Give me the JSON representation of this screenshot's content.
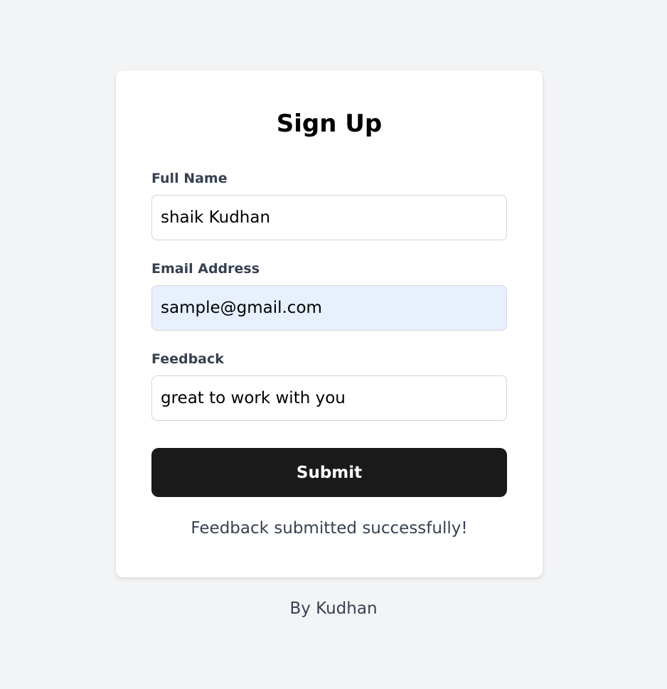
{
  "title": "Sign Up",
  "fields": [
    {
      "label": "Full Name",
      "value": "shaik Kudhan"
    },
    {
      "label": "Email Address",
      "value": "sample@gmail.com"
    },
    {
      "label": "Feedback",
      "value": "great to work with you"
    }
  ],
  "submit_label": "Submit",
  "status_message": "Feedback submitted successfully!",
  "footer": "By Kudhan"
}
